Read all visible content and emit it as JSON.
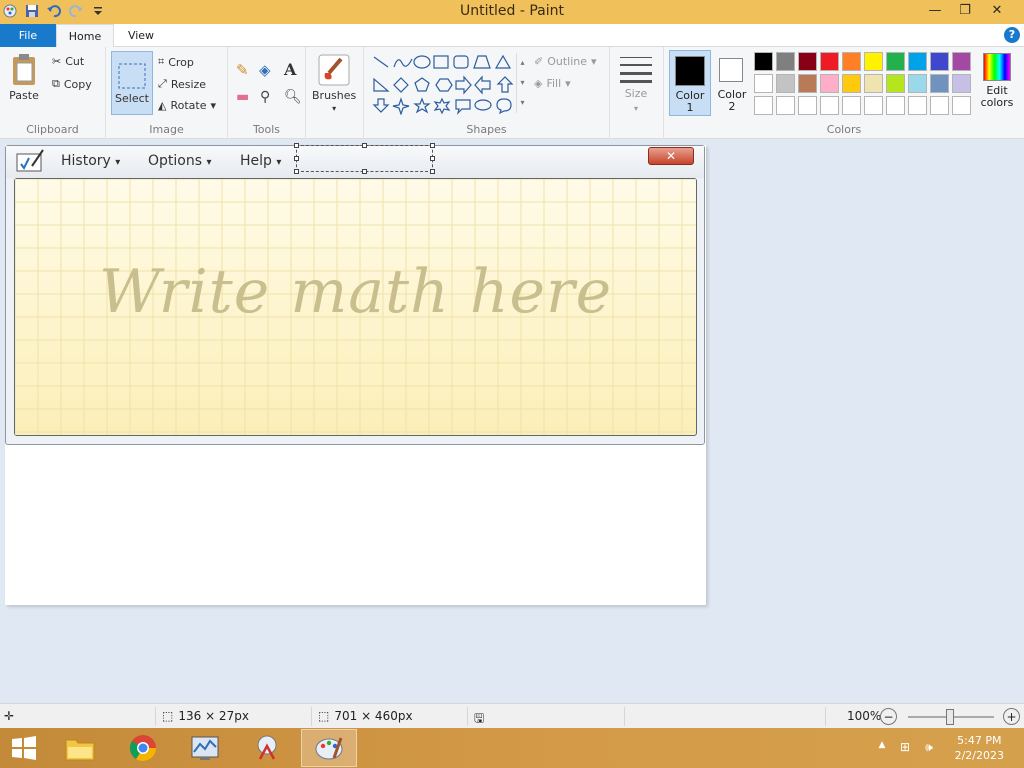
{
  "window": {
    "title": "Untitled - Paint"
  },
  "tabs": {
    "file": "File",
    "home": "Home",
    "view": "View"
  },
  "ribbon": {
    "clipboard": {
      "label": "Clipboard",
      "paste": "Paste",
      "cut": "Cut",
      "copy": "Copy"
    },
    "image": {
      "label": "Image",
      "select": "Select",
      "crop": "Crop",
      "resize": "Resize",
      "rotate": "Rotate"
    },
    "tools": {
      "label": "Tools"
    },
    "brushes": {
      "label": "Brushes"
    },
    "shapes": {
      "label": "Shapes",
      "outline": "Outline",
      "fill": "Fill"
    },
    "size": {
      "label": "Size"
    },
    "colors": {
      "label": "Colors",
      "color1": "Color",
      "color1_num": "1",
      "color2": "Color",
      "color2_num": "2",
      "edit": "Edit",
      "edit2": "colors",
      "color1_value": "#000000",
      "color2_value": "#ffffff",
      "palette_row1": [
        "#000000",
        "#7f7f7f",
        "#880015",
        "#ed1c24",
        "#ff7f27",
        "#fff200",
        "#22b14c",
        "#00a2e8",
        "#3f48cc",
        "#a349a4"
      ],
      "palette_row2": [
        "#ffffff",
        "#c3c3c3",
        "#b97a57",
        "#ffaec9",
        "#ffc90e",
        "#efe4b0",
        "#b5e61d",
        "#99d9ea",
        "#7092be",
        "#c8bfe7"
      ],
      "palette_row3": [
        "#ffffff",
        "#ffffff",
        "#ffffff",
        "#ffffff",
        "#ffffff",
        "#ffffff",
        "#ffffff",
        "#ffffff",
        "#ffffff",
        "#ffffff"
      ]
    }
  },
  "math_panel": {
    "history": "History",
    "options": "Options",
    "help": "Help",
    "placeholder": "Write math here"
  },
  "status": {
    "selection_size": "136 × 27px",
    "canvas_size": "701 × 460px",
    "zoom": "100%"
  },
  "clock": {
    "time": "5:47 PM",
    "date": "2/2/2023"
  }
}
